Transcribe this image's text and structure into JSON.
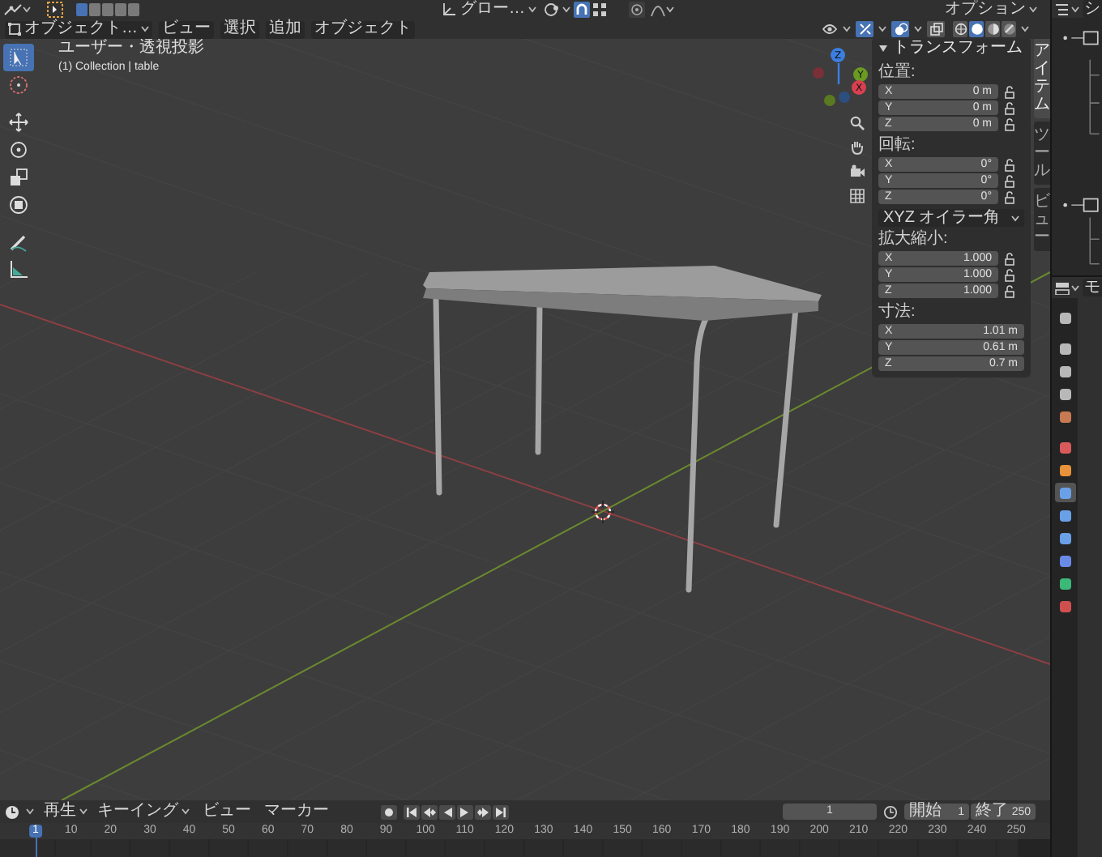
{
  "top_bar": {
    "mode_buttons": [
      {
        "selected": true
      },
      {
        "selected": false
      },
      {
        "selected": false
      },
      {
        "selected": false
      },
      {
        "selected": false
      }
    ],
    "orientation": "グロー…",
    "snap": {
      "on": true
    },
    "options": "オプション"
  },
  "viewport_header": {
    "mode": "オブジェクト…",
    "menus": [
      "ビュー",
      "選択",
      "追加",
      "オブジェクト"
    ],
    "gizmos": {
      "on": true
    },
    "overlays": {
      "on": true
    },
    "xray": {
      "on": false
    },
    "shading": [
      {
        "selected": false
      },
      {
        "selected": true
      },
      {
        "selected": false
      },
      {
        "selected": false
      }
    ]
  },
  "viewport": {
    "view_name": "ユーザー・透視投影",
    "object_info": "(1) Collection | table",
    "tools": [
      {
        "selected": true
      },
      {
        "selected": false
      },
      {
        "selected": false
      },
      {
        "selected": false
      },
      {
        "selected": false
      },
      {
        "selected": false
      },
      {
        "selected": false
      },
      {
        "selected": false
      }
    ],
    "gizmo_axes": [
      "Z",
      "Y",
      "X"
    ]
  },
  "sidebar": {
    "tabs": [
      {
        "label": "アイテム",
        "selected": true
      },
      {
        "label": "ツール",
        "selected": false
      },
      {
        "label": "ビュー",
        "selected": false
      }
    ],
    "panel": {
      "title": "トランスフォーム",
      "expanded": true,
      "sections": [
        {
          "kind": "fields",
          "label": "位置:",
          "locks": true,
          "rows": [
            {
              "axis": "X",
              "value": "0 m"
            },
            {
              "axis": "Y",
              "value": "0 m"
            },
            {
              "axis": "Z",
              "value": "0 m"
            }
          ]
        },
        {
          "kind": "fields",
          "label": "回転:",
          "locks": true,
          "rows": [
            {
              "axis": "X",
              "value": "0°"
            },
            {
              "axis": "Y",
              "value": "0°"
            },
            {
              "axis": "Z",
              "value": "0°"
            }
          ]
        },
        {
          "kind": "dropdown",
          "value": "XYZ オイラー角"
        },
        {
          "kind": "fields",
          "label": "拡大縮小:",
          "locks": true,
          "rows": [
            {
              "axis": "X",
              "value": "1.000"
            },
            {
              "axis": "Y",
              "value": "1.000"
            },
            {
              "axis": "Z",
              "value": "1.000"
            }
          ]
        },
        {
          "kind": "fields",
          "label": "寸法:",
          "locks": false,
          "rows": [
            {
              "axis": "X",
              "value": "1.01 m"
            },
            {
              "axis": "Y",
              "value": "0.61 m"
            },
            {
              "axis": "Z",
              "value": "0.7 m"
            }
          ]
        }
      ]
    }
  },
  "outliner": {
    "header": "シ"
  },
  "properties": {
    "header": "モ",
    "tabs": [
      {
        "color": "#b8b8b8",
        "selected": false
      },
      {
        "color": "#b8b8b8",
        "selected": false
      },
      {
        "color": "#b8b8b8",
        "selected": false
      },
      {
        "color": "#b8b8b8",
        "selected": false
      },
      {
        "color": "#c77a52",
        "selected": false
      },
      {
        "color": "#d85a5a",
        "selected": false
      },
      {
        "color": "#e8923a",
        "selected": false
      },
      {
        "color": "#6aa0e8",
        "selected": true
      },
      {
        "color": "#6aa0e8",
        "selected": false
      },
      {
        "color": "#6aa0e8",
        "selected": false
      },
      {
        "color": "#6a8ae8",
        "selected": false
      },
      {
        "color": "#3cb878",
        "selected": false
      },
      {
        "color": "#d05050",
        "selected": false
      }
    ]
  },
  "timeline": {
    "menus": [
      {
        "label": "再生",
        "kind": "dropdown"
      },
      {
        "label": "キーイング",
        "kind": "dropdown"
      },
      {
        "label": "ビュー",
        "kind": "menu"
      },
      {
        "label": "マーカー",
        "kind": "menu"
      }
    ],
    "current_frame": "1",
    "start_label": "開始",
    "start": "1",
    "end_label": "終了",
    "end": "250",
    "ruler": [
      {
        "label": "1",
        "current": true
      },
      {
        "label": "10",
        "current": false
      },
      {
        "label": "20",
        "current": false
      },
      {
        "label": "30",
        "current": false
      },
      {
        "label": "40",
        "current": false
      },
      {
        "label": "50",
        "current": false
      },
      {
        "label": "60",
        "current": false
      },
      {
        "label": "70",
        "current": false
      },
      {
        "label": "80",
        "current": false
      },
      {
        "label": "90",
        "current": false
      },
      {
        "label": "100",
        "current": false
      },
      {
        "label": "110",
        "current": false
      },
      {
        "label": "120",
        "current": false
      },
      {
        "label": "130",
        "current": false
      },
      {
        "label": "140",
        "current": false
      },
      {
        "label": "150",
        "current": false
      },
      {
        "label": "160",
        "current": false
      },
      {
        "label": "170",
        "current": false
      },
      {
        "label": "180",
        "current": false
      },
      {
        "label": "190",
        "current": false
      },
      {
        "label": "200",
        "current": false
      },
      {
        "label": "210",
        "current": false
      },
      {
        "label": "220",
        "current": false
      },
      {
        "label": "230",
        "current": false
      },
      {
        "label": "240",
        "current": false
      },
      {
        "label": "250",
        "current": false
      }
    ]
  }
}
